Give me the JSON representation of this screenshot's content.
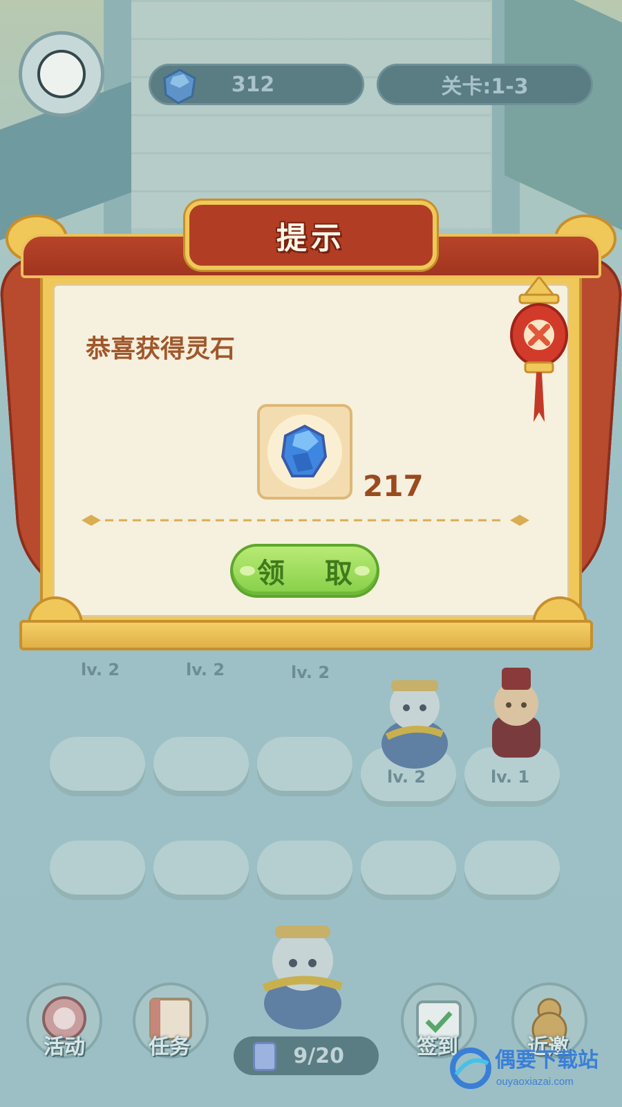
{
  "hud": {
    "gem_count": "312",
    "level_text": "关卡:1-3"
  },
  "dialog": {
    "title": "提示",
    "message": "恭喜获得灵石",
    "reward_amount": "217",
    "claim_label": "领 取"
  },
  "grid": {
    "row1_levels": [
      "lv. 2",
      "lv. 2",
      "lv. 2"
    ],
    "row2_levels": [
      "lv. 2",
      "lv. 1"
    ]
  },
  "bottom_bar": {
    "activity_label": "活动",
    "task_label": "任务",
    "progress_text": "9/20",
    "signin_label": "签到",
    "invite_label": "近邀"
  },
  "watermark": {
    "main": "偶要下载站",
    "sub": "ouyaoxiazai.com"
  },
  "colors": {
    "overlay": "#9fc3c6",
    "panel": "#f6f0de",
    "frame_gold": "#f0c85a",
    "roof_red": "#b13e24",
    "message_text": "#a0572b",
    "button_green": "#86cf48"
  }
}
